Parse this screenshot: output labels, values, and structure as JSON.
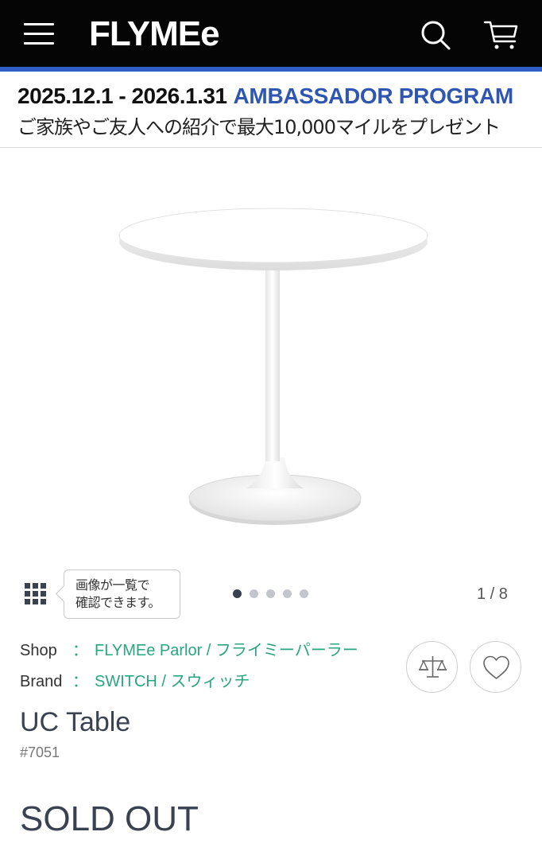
{
  "header": {
    "logo": "FLYMEe",
    "menu_icon": "hamburger-menu-icon",
    "search_icon": "search-icon",
    "cart_icon": "cart-icon",
    "accent_color": "#2f5fc4"
  },
  "banner": {
    "dates": "2025.12.1 - 2026.1.31",
    "program": "AMBASSADOR PROGRAM",
    "subtitle": "ご家族やご友人への紹介で最大10,000マイルをプレゼント"
  },
  "gallery": {
    "grid_icon": "grid-icon",
    "tooltip": "画像が一覧で\n確認できます。",
    "dot_count": 5,
    "active_dot": 0,
    "counter": "1 / 8"
  },
  "product": {
    "shop_label": "Shop",
    "shop_value": "FLYMEe Parlor / フライミーパーラー",
    "brand_label": "Brand",
    "brand_value": "SWITCH / スウィッチ",
    "colon": "：",
    "title": "UC Table",
    "id": "#7051",
    "status": "SOLD OUT",
    "compare_icon": "scale-compare-icon",
    "favorite_icon": "heart-icon",
    "link_color": "#2aa582"
  }
}
